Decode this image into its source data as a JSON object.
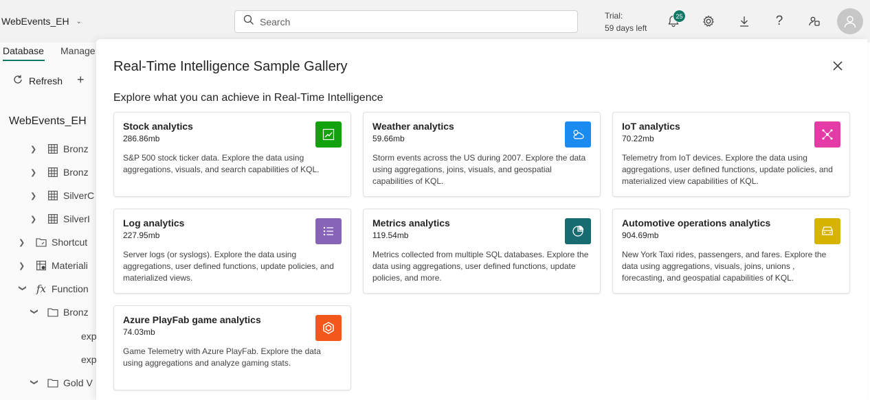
{
  "topbar": {
    "workspace": "WebEvents_EH",
    "search_placeholder": "Search",
    "trial_line1": "Trial:",
    "trial_line2": "59 days left",
    "notification_count": "25",
    "icons": [
      "bell-icon",
      "gear-icon",
      "download-icon",
      "help-icon",
      "share-icon",
      "avatar"
    ]
  },
  "leftpanel": {
    "tabs": [
      {
        "label": "Database",
        "active": true
      },
      {
        "label": "Manage",
        "active": false
      }
    ],
    "refresh_label": "Refresh",
    "db_name": "WebEvents_EH",
    "tree": [
      {
        "label": "Bronz",
        "icon": "table-icon"
      },
      {
        "label": "Bronz",
        "icon": "table-icon"
      },
      {
        "label": "SilverC",
        "icon": "table-icon"
      },
      {
        "label": "SilverI",
        "icon": "table-icon"
      },
      {
        "label": "Shortcut",
        "icon": "shortcut-folder-icon"
      },
      {
        "label": "Materiali",
        "icon": "materialized-view-icon"
      },
      {
        "label": "Function",
        "icon": "function-icon"
      },
      {
        "label": "Bronz",
        "icon": "folder-icon"
      },
      {
        "label": "exp",
        "icon": ""
      },
      {
        "label": "exp",
        "icon": ""
      },
      {
        "label": "Gold V",
        "icon": "folder-icon"
      }
    ]
  },
  "gallery": {
    "title": "Real-Time Intelligence Sample Gallery",
    "subtitle": "Explore what you can achieve in Real-Time Intelligence",
    "cards": [
      {
        "title": "Stock analytics",
        "size": "286.86mb",
        "desc": "S&P 500 stock ticker data. Explore the data using aggregations, visuals, and search capabilities of KQL.",
        "icon": "trend-chart-icon",
        "color": "#13a10e"
      },
      {
        "title": "Weather analytics",
        "size": "59.66mb",
        "desc": "Storm events across the US during 2007. Explore the data using aggregations, joins, visuals, and geospatial capabilities of KQL.",
        "icon": "weather-icon",
        "color": "#1b8bf0"
      },
      {
        "title": "IoT analytics",
        "size": "70.22mb",
        "desc": "Telemetry from IoT devices. Explore the data using aggregations, user defined functions, update policies, and materialized view capabilities of KQL.",
        "icon": "iot-network-icon",
        "color": "#e43ba6"
      },
      {
        "title": "Log analytics",
        "size": "227.95mb",
        "desc": "Server logs (or syslogs). Explore the data using aggregations, user defined functions, update policies, and materialized views.",
        "icon": "list-icon",
        "color": "#8764b8"
      },
      {
        "title": "Metrics analytics",
        "size": "119.54mb",
        "desc": "Metrics collected from multiple SQL databases. Explore the data using aggregations, user defined functions, update policies, and more.",
        "icon": "pie-chart-icon",
        "color": "#196b72"
      },
      {
        "title": "Automotive operations analytics",
        "size": "904.69mb",
        "desc": "New York Taxi rides, passengers, and fares. Explore the data using aggregations, visuals, joins, unions , forecasting, and geospatial capabilities of KQL.",
        "icon": "car-icon",
        "color": "#d6b300"
      },
      {
        "title": "Azure PlayFab game analytics",
        "size": "74.03mb",
        "desc": "Game Telemetry with Azure PlayFab. Explore the data using aggregations and analyze gaming stats.",
        "icon": "playfab-icon",
        "color": "#f2581b"
      }
    ]
  }
}
